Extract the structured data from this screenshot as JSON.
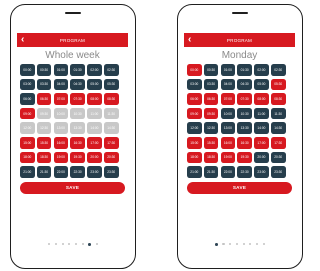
{
  "colors": {
    "accent": "#d71920",
    "slot_dark": "#263e4c",
    "slot_grey": "#c8c8c8",
    "dot_active": "#2f4656"
  },
  "phones": [
    {
      "id": "left",
      "header_title": "PROGRAM",
      "back_icon": "chevron-left-icon",
      "title": "Whole week",
      "save_label": "SAVE",
      "dots_total": 8,
      "dots_active": 7,
      "rows": [
        [
          {
            "t": "00:00",
            "s": "dark"
          },
          {
            "t": "00:30",
            "s": "dark"
          },
          {
            "t": "01:00",
            "s": "dark"
          },
          {
            "t": "01:30",
            "s": "dark"
          },
          {
            "t": "02:00",
            "s": "dark"
          },
          {
            "t": "02:30",
            "s": "dark"
          }
        ],
        [
          {
            "t": "03:00",
            "s": "dark"
          },
          {
            "t": "03:30",
            "s": "dark"
          },
          {
            "t": "04:00",
            "s": "dark"
          },
          {
            "t": "04:30",
            "s": "dark"
          },
          {
            "t": "05:00",
            "s": "dark"
          },
          {
            "t": "05:30",
            "s": "dark"
          }
        ],
        [
          {
            "t": "06:00",
            "s": "dark"
          },
          {
            "t": "06:30",
            "s": "red"
          },
          {
            "t": "07:00",
            "s": "red"
          },
          {
            "t": "07:30",
            "s": "red"
          },
          {
            "t": "08:00",
            "s": "red"
          },
          {
            "t": "08:30",
            "s": "red"
          }
        ],
        [
          {
            "t": "09:00",
            "s": "red"
          },
          {
            "t": "09:30",
            "s": "grey"
          },
          {
            "t": "10:00",
            "s": "grey"
          },
          {
            "t": "10:30",
            "s": "grey"
          },
          {
            "t": "11:00",
            "s": "grey"
          },
          {
            "t": "11:30",
            "s": "grey"
          }
        ],
        [
          {
            "t": "12:00",
            "s": "grey"
          },
          {
            "t": "12:30",
            "s": "grey"
          },
          {
            "t": "13:00",
            "s": "grey"
          },
          {
            "t": "13:30",
            "s": "grey"
          },
          {
            "t": "14:00",
            "s": "grey"
          },
          {
            "t": "14:30",
            "s": "grey"
          }
        ],
        [
          {
            "t": "15:00",
            "s": "red"
          },
          {
            "t": "15:30",
            "s": "red"
          },
          {
            "t": "16:00",
            "s": "red"
          },
          {
            "t": "16:30",
            "s": "red"
          },
          {
            "t": "17:00",
            "s": "red"
          },
          {
            "t": "17:30",
            "s": "red"
          }
        ],
        [
          {
            "t": "18:00",
            "s": "red"
          },
          {
            "t": "18:30",
            "s": "red"
          },
          {
            "t": "19:00",
            "s": "red"
          },
          {
            "t": "19:30",
            "s": "red"
          },
          {
            "t": "20:00",
            "s": "red"
          },
          {
            "t": "20:30",
            "s": "red"
          }
        ],
        [
          {
            "t": "21:00",
            "s": "dark"
          },
          {
            "t": "21:30",
            "s": "dark"
          },
          {
            "t": "22:00",
            "s": "dark"
          },
          {
            "t": "22:30",
            "s": "dark"
          },
          {
            "t": "23:00",
            "s": "dark"
          },
          {
            "t": "23:30",
            "s": "dark"
          }
        ]
      ]
    },
    {
      "id": "right",
      "header_title": "PROGRAM",
      "back_icon": "chevron-left-icon",
      "title": "Monday",
      "save_label": "SAVE",
      "dots_total": 8,
      "dots_active": 1,
      "rows": [
        [
          {
            "t": "00:00",
            "s": "red"
          },
          {
            "t": "00:30",
            "s": "dark"
          },
          {
            "t": "01:00",
            "s": "dark"
          },
          {
            "t": "01:30",
            "s": "dark"
          },
          {
            "t": "02:00",
            "s": "dark"
          },
          {
            "t": "02:30",
            "s": "dark"
          }
        ],
        [
          {
            "t": "03:00",
            "s": "dark"
          },
          {
            "t": "03:30",
            "s": "dark"
          },
          {
            "t": "04:00",
            "s": "dark"
          },
          {
            "t": "04:30",
            "s": "dark"
          },
          {
            "t": "05:00",
            "s": "dark"
          },
          {
            "t": "05:30",
            "s": "red"
          }
        ],
        [
          {
            "t": "06:00",
            "s": "red"
          },
          {
            "t": "06:30",
            "s": "red"
          },
          {
            "t": "07:00",
            "s": "red"
          },
          {
            "t": "07:30",
            "s": "red"
          },
          {
            "t": "08:00",
            "s": "red"
          },
          {
            "t": "08:30",
            "s": "red"
          }
        ],
        [
          {
            "t": "09:00",
            "s": "red"
          },
          {
            "t": "09:30",
            "s": "red"
          },
          {
            "t": "10:00",
            "s": "dark"
          },
          {
            "t": "10:30",
            "s": "dark"
          },
          {
            "t": "11:00",
            "s": "dark"
          },
          {
            "t": "11:30",
            "s": "dark"
          }
        ],
        [
          {
            "t": "12:00",
            "s": "dark"
          },
          {
            "t": "12:30",
            "s": "dark"
          },
          {
            "t": "13:00",
            "s": "dark"
          },
          {
            "t": "13:30",
            "s": "dark"
          },
          {
            "t": "14:00",
            "s": "dark"
          },
          {
            "t": "14:30",
            "s": "dark"
          }
        ],
        [
          {
            "t": "15:00",
            "s": "red"
          },
          {
            "t": "15:30",
            "s": "red"
          },
          {
            "t": "16:00",
            "s": "red"
          },
          {
            "t": "16:30",
            "s": "red"
          },
          {
            "t": "17:00",
            "s": "red"
          },
          {
            "t": "17:30",
            "s": "red"
          }
        ],
        [
          {
            "t": "18:00",
            "s": "red"
          },
          {
            "t": "18:30",
            "s": "red"
          },
          {
            "t": "19:00",
            "s": "red"
          },
          {
            "t": "19:30",
            "s": "red"
          },
          {
            "t": "20:00",
            "s": "dark"
          },
          {
            "t": "20:30",
            "s": "dark"
          }
        ],
        [
          {
            "t": "21:00",
            "s": "dark"
          },
          {
            "t": "21:30",
            "s": "dark"
          },
          {
            "t": "22:00",
            "s": "dark"
          },
          {
            "t": "22:30",
            "s": "dark"
          },
          {
            "t": "23:00",
            "s": "dark"
          },
          {
            "t": "23:30",
            "s": "dark"
          }
        ]
      ]
    }
  ]
}
